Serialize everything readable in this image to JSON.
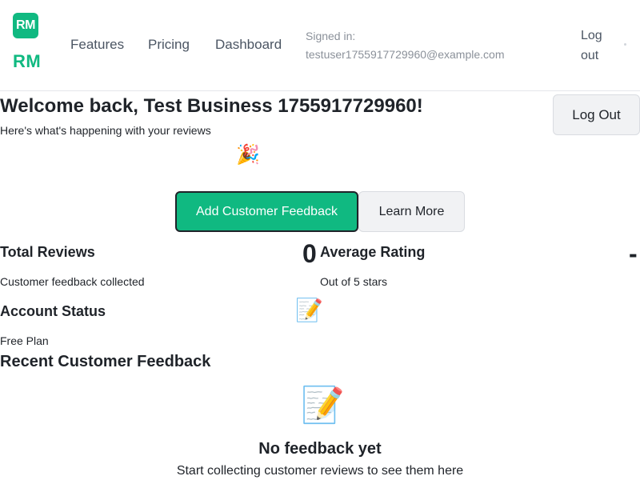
{
  "header": {
    "logo_badge": "RM",
    "logo_text": "RM",
    "nav": [
      {
        "label": "Features"
      },
      {
        "label": "Pricing"
      },
      {
        "label": "Dashboard"
      }
    ],
    "signed_in_label": "Signed in:",
    "signed_in_email": "testuser1755917729960@example.com",
    "logout_label": "Log out"
  },
  "welcome": {
    "title": "Welcome back, Test Business 1755917729960!",
    "subtitle": "Here's what's happening with your reviews",
    "logout_button": "Log Out",
    "icon": "party-popper-icon"
  },
  "actions": {
    "primary": "Add Customer Feedback",
    "secondary": "Learn More"
  },
  "stats": {
    "total_reviews": {
      "title": "Total Reviews",
      "value": "0",
      "subtitle": "Customer feedback collected"
    },
    "average_rating": {
      "title": "Average Rating",
      "value": "-",
      "subtitle": "Out of 5 stars"
    },
    "account_status": {
      "title": "Account Status",
      "subtitle": "Free Plan",
      "icon": "memo-pencil-icon"
    }
  },
  "recent": {
    "title": "Recent Customer Feedback",
    "empty_icon": "memo-pencil-icon",
    "empty_title": "No feedback yet",
    "empty_subtitle": "Start collecting customer reviews to see them here"
  },
  "colors": {
    "brand": "#10b981",
    "text": "#1f2329",
    "muted": "#8b919a",
    "button_bg": "#f1f2f4"
  }
}
